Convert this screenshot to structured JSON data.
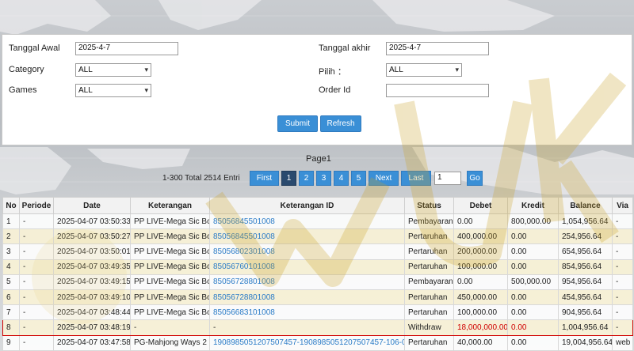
{
  "filters": {
    "start_date_label": "Tanggal Awal",
    "start_date_value": "2025-4-7",
    "end_date_label": "Tanggal akhir",
    "end_date_value": "2025-4-7",
    "category_label": "Category",
    "category_value": "ALL",
    "pilih_label": "Pilih ：",
    "pilih_value": "ALL",
    "games_label": "Games",
    "games_value": "ALL",
    "order_label": "Order Id",
    "order_value": "",
    "submit_label": "Submit",
    "refresh_label": "Refresh"
  },
  "pagination": {
    "page_label": "Page1",
    "total_label": "1-300 Total 2514 Entri",
    "first_label": "First",
    "pages": [
      "1",
      "2",
      "3",
      "4",
      "5"
    ],
    "active_page": "1",
    "next_label": "Next",
    "last_label": "Last",
    "jump_value": "1",
    "go_label": "Go"
  },
  "table": {
    "headers": [
      "No",
      "Periode",
      "Date",
      "Keterangan",
      "Keterangan ID",
      "Status",
      "Debet",
      "Kredit",
      "Balance",
      "Via"
    ],
    "rows": [
      [
        "1",
        "-",
        "2025-04-07 03:50:33",
        "PP LIVE-Mega Sic Bo",
        "85056845501008",
        "Pembayaran",
        "0.00",
        "800,000.00",
        "1,054,956.64",
        "-"
      ],
      [
        "2",
        "-",
        "2025-04-07 03:50:27",
        "PP LIVE-Mega Sic Bo",
        "85056845501008",
        "Pertaruhan",
        "400,000.00",
        "0.00",
        "254,956.64",
        "-"
      ],
      [
        "3",
        "-",
        "2025-04-07 03:50:01",
        "PP LIVE-Mega Sic Bo",
        "85056802301008",
        "Pertaruhan",
        "200,000.00",
        "0.00",
        "654,956.64",
        "-"
      ],
      [
        "4",
        "-",
        "2025-04-07 03:49:35",
        "PP LIVE-Mega Sic Bo",
        "85056760101008",
        "Pertaruhan",
        "100,000.00",
        "0.00",
        "854,956.64",
        "-"
      ],
      [
        "5",
        "-",
        "2025-04-07 03:49:15",
        "PP LIVE-Mega Sic Bo",
        "85056728801008",
        "Pembayaran",
        "0.00",
        "500,000.00",
        "954,956.64",
        "-"
      ],
      [
        "6",
        "-",
        "2025-04-07 03:49:10",
        "PP LIVE-Mega Sic Bo",
        "85056728801008",
        "Pertaruhan",
        "450,000.00",
        "0.00",
        "454,956.64",
        "-"
      ],
      [
        "7",
        "-",
        "2025-04-07 03:48:44",
        "PP LIVE-Mega Sic Bo",
        "85056683101008",
        "Pertaruhan",
        "100,000.00",
        "0.00",
        "904,956.64",
        "-"
      ],
      [
        "8",
        "-",
        "2025-04-07 03:48:19",
        "-",
        "-",
        "Withdraw",
        "18,000,000.00",
        "0.00",
        "1,004,956.64",
        "-"
      ],
      [
        "9",
        "-",
        "2025-04-07 03:47:58",
        "PG-Mahjong Ways 2",
        "1908985051207507457-1908985051207507457-106-0",
        "Pertaruhan",
        "40,000.00",
        "0.00",
        "19,004,956.64",
        "web"
      ]
    ],
    "highlight_row": 8,
    "link_color": "#2a7bc7",
    "highlight_color": "#d00000"
  },
  "colors": {
    "button_blue": "#3a8fd6",
    "active_page": "#2a4a6e",
    "alt_row": "#fcf4d6"
  }
}
